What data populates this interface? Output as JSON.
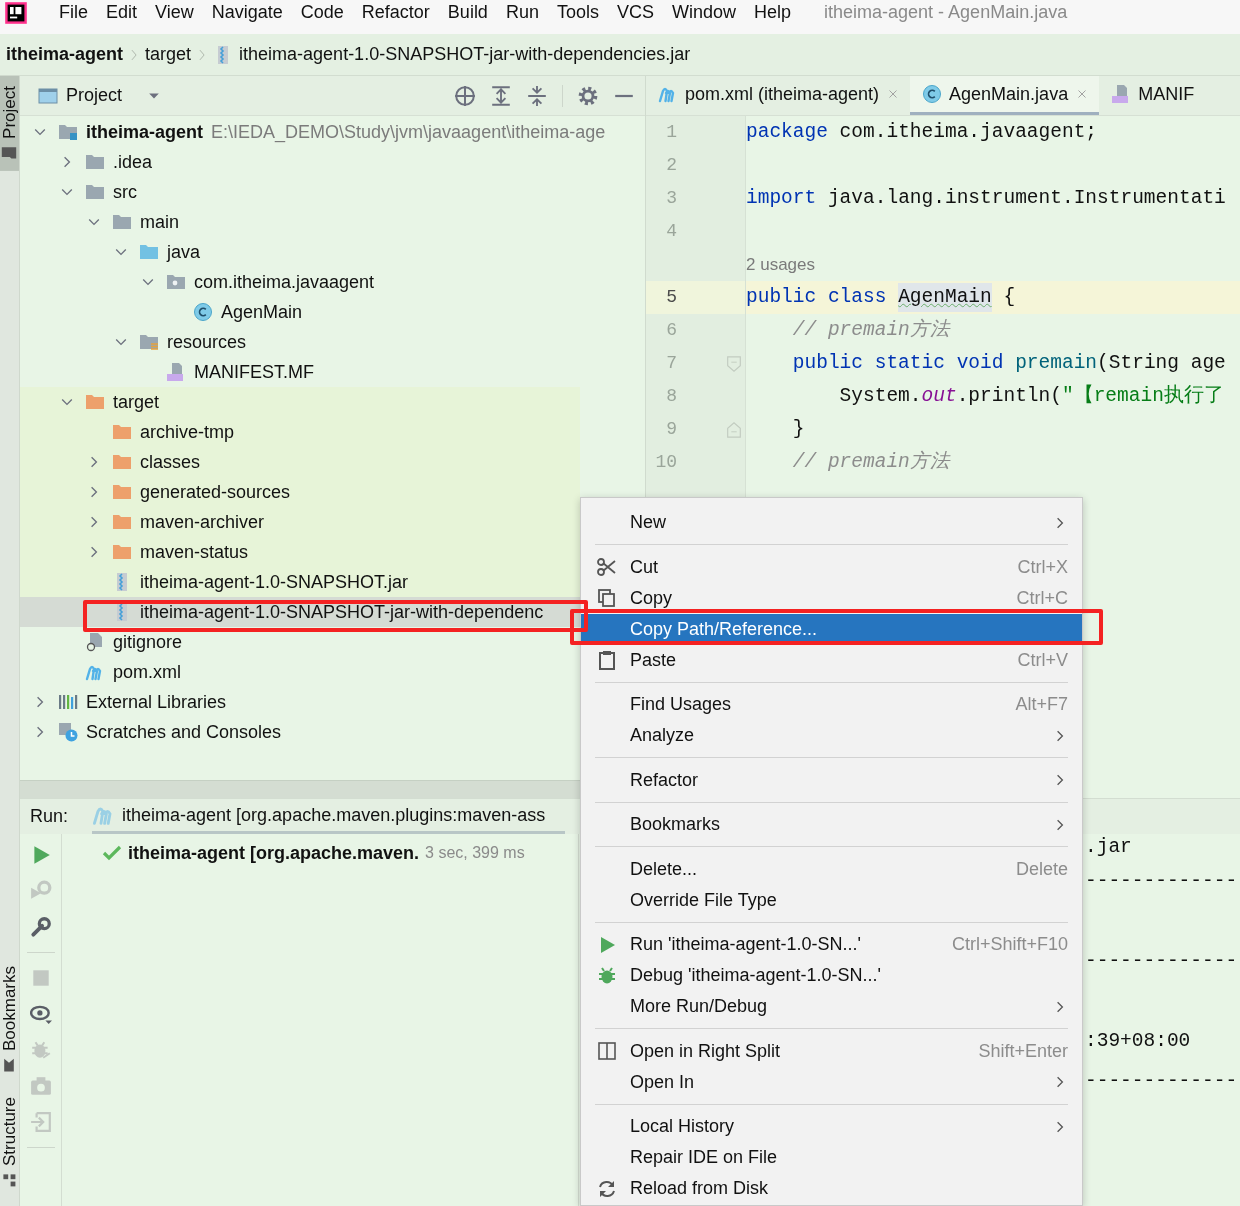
{
  "menubar": {
    "menus": [
      "File",
      "Edit",
      "View",
      "Navigate",
      "Code",
      "Refactor",
      "Build",
      "Run",
      "Tools",
      "VCS",
      "Window",
      "Help"
    ],
    "title": "itheima-agent - AgenMain.java"
  },
  "breadcrumbs": [
    {
      "label": "itheima-agent",
      "kind": "project"
    },
    {
      "label": "target",
      "kind": "folder"
    },
    {
      "label": "itheima-agent-1.0-SNAPSHOT-jar-with-dependencies.jar",
      "kind": "jar"
    }
  ],
  "side_tabs": [
    {
      "label": "Project",
      "kind": "project",
      "selected": true
    },
    {
      "label": "Bookmarks",
      "kind": "bookmarks",
      "selected": false
    },
    {
      "label": "Structure",
      "kind": "structure",
      "selected": false
    }
  ],
  "project_panel": {
    "title": "Project",
    "tree": [
      {
        "label": "itheima-agent",
        "path": "E:\\IEDA_DEMO\\Study\\jvm\\javaagent\\itheima-age",
        "kind": "project-folder",
        "expanded": true,
        "selected": false,
        "children": [
          {
            "label": ".idea",
            "kind": "folder",
            "expanded": false,
            "selected": false,
            "excluded": false
          },
          {
            "label": "src",
            "kind": "folder",
            "expanded": true,
            "selected": false,
            "excluded": false,
            "children": [
              {
                "label": "main",
                "kind": "folder",
                "expanded": true,
                "selected": false,
                "children": [
                  {
                    "label": "java",
                    "kind": "source-folder",
                    "expanded": true,
                    "selected": false,
                    "children": [
                      {
                        "label": "com.itheima.javaagent",
                        "kind": "package",
                        "expanded": true,
                        "selected": false,
                        "children": [
                          {
                            "label": "AgenMain",
                            "kind": "class",
                            "selected": false
                          }
                        ]
                      }
                    ]
                  },
                  {
                    "label": "resources",
                    "kind": "resources",
                    "expanded": true,
                    "selected": false,
                    "children": [
                      {
                        "label": "MANIFEST.MF",
                        "kind": "manifest",
                        "selected": false
                      }
                    ]
                  }
                ]
              }
            ]
          },
          {
            "label": "target",
            "kind": "excluded-folder",
            "expanded": true,
            "selected": false,
            "excluded": true,
            "children": [
              {
                "label": "archive-tmp",
                "kind": "excluded-folder",
                "selected": false
              },
              {
                "label": "classes",
                "kind": "excluded-folder",
                "expanded": false,
                "selected": false
              },
              {
                "label": "generated-sources",
                "kind": "excluded-folder",
                "expanded": false,
                "selected": false
              },
              {
                "label": "maven-archiver",
                "kind": "excluded-folder",
                "expanded": false,
                "selected": false
              },
              {
                "label": "maven-status",
                "kind": "excluded-folder",
                "expanded": false,
                "selected": false
              },
              {
                "label": "itheima-agent-1.0-SNAPSHOT.jar",
                "kind": "jar",
                "selected": false
              },
              {
                "label": "itheima-agent-1.0-SNAPSHOT-jar-with-dependenc",
                "kind": "jar",
                "selected": true
              }
            ]
          },
          {
            "label": "gitignore",
            "kind": "gitignore",
            "selected": false,
            "excluded": false
          },
          {
            "label": "pom.xml",
            "kind": "maven",
            "selected": false,
            "excluded": false
          }
        ]
      },
      {
        "label": "External Libraries",
        "kind": "libraries",
        "expanded": false,
        "selected": false
      },
      {
        "label": "Scratches and Consoles",
        "kind": "scratches",
        "expanded": false,
        "selected": false
      }
    ]
  },
  "editor": {
    "tabs": [
      {
        "label": "pom.xml (itheima-agent)",
        "kind": "maven",
        "selected": false,
        "closable": true
      },
      {
        "label": "AgenMain.java",
        "kind": "class",
        "selected": true,
        "closable": true
      },
      {
        "label": "MANIF",
        "kind": "manifest",
        "selected": false,
        "closable": false
      }
    ],
    "lines": [
      {
        "kind": "code",
        "number": "1",
        "current": false,
        "tokens": [
          {
            "kind": "keyword",
            "text": "package"
          },
          {
            "kind": "plain",
            "text": " com.itheima.javaagent;"
          }
        ]
      },
      {
        "kind": "code",
        "number": "2",
        "current": false
      },
      {
        "kind": "code",
        "number": "3",
        "current": false,
        "tokens": [
          {
            "kind": "keyword",
            "text": "import"
          },
          {
            "kind": "plain",
            "text": " java.lang.instrument.Instrumentati"
          }
        ]
      },
      {
        "kind": "code",
        "number": "4",
        "current": false
      },
      {
        "kind": "hint",
        "text": "2 usages"
      },
      {
        "kind": "code",
        "number": "5",
        "current": true,
        "tokens": [
          {
            "kind": "keyword",
            "text": "public class "
          },
          {
            "kind": "highlight",
            "text": "AgenMain"
          },
          {
            "kind": "plain",
            "text": " {"
          }
        ]
      },
      {
        "kind": "code",
        "number": "6",
        "current": false,
        "tokens": [
          {
            "kind": "comment",
            "text": "    // premain方法"
          }
        ]
      },
      {
        "kind": "code",
        "number": "7",
        "current": false,
        "fold_start": true,
        "tokens": [
          {
            "kind": "keyword",
            "text": "    public static void"
          },
          {
            "kind": "method",
            "text": " premain"
          },
          {
            "kind": "plain",
            "text": "(String age"
          }
        ]
      },
      {
        "kind": "code",
        "number": "8",
        "current": false,
        "tokens": [
          {
            "kind": "plain",
            "text": "        System."
          },
          {
            "kind": "field",
            "text": "out"
          },
          {
            "kind": "plain",
            "text": ".println("
          },
          {
            "kind": "string",
            "text": "\"【remain执行了"
          }
        ]
      },
      {
        "kind": "code",
        "number": "9",
        "current": false,
        "fold_end": true,
        "tokens": [
          {
            "kind": "plain",
            "text": "    }"
          }
        ]
      },
      {
        "kind": "code",
        "number": "10",
        "current": false,
        "tokens": [
          {
            "kind": "comment",
            "text": "    // premain方法"
          }
        ]
      }
    ]
  },
  "run_panel": {
    "label": "Run:",
    "tab": {
      "label": "itheima-agent [org.apache.maven.plugins:maven-ass",
      "kind": "maven"
    },
    "toolbar": [
      {
        "kind": "play",
        "disabled": false
      },
      {
        "kind": "rerun",
        "disabled": true
      },
      {
        "kind": "wrench",
        "disabled": false
      },
      {
        "kind": "separator"
      },
      {
        "kind": "stop",
        "disabled": true
      },
      {
        "kind": "eye",
        "disabled": false
      },
      {
        "kind": "bug",
        "disabled": true
      },
      {
        "kind": "camera",
        "disabled": true
      },
      {
        "kind": "exit",
        "disabled": true
      },
      {
        "kind": "separator"
      }
    ],
    "tree": [
      {
        "label": "itheima-agent [org.apache.maven.",
        "time": "3 sec, 399 ms",
        "succeeded": true
      }
    ],
    "console": [
      {
        "kind": "text",
        "text": ".jar"
      },
      {
        "kind": "text",
        "text": "-------------"
      },
      {
        "kind": "blank"
      },
      {
        "kind": "text",
        "text": "-------------"
      },
      {
        "kind": "blank"
      },
      {
        "kind": "text",
        "text": ":39+08:00"
      },
      {
        "kind": "text",
        "text": "-------------"
      }
    ]
  },
  "context_menu": [
    {
      "kind": "item",
      "label": "New",
      "submenu": true,
      "selected": false
    },
    {
      "kind": "separator"
    },
    {
      "kind": "cut",
      "label": "Cut",
      "shortcut": "Ctrl+X",
      "submenu": false,
      "selected": false
    },
    {
      "kind": "copy",
      "label": "Copy",
      "shortcut": "Ctrl+C",
      "submenu": false,
      "selected": false
    },
    {
      "kind": "item",
      "label": "Copy Path/Reference...",
      "submenu": false,
      "selected": true
    },
    {
      "kind": "paste",
      "label": "Paste",
      "shortcut": "Ctrl+V",
      "submenu": false,
      "selected": false
    },
    {
      "kind": "separator"
    },
    {
      "kind": "item",
      "label": "Find Usages",
      "shortcut": "Alt+F7",
      "submenu": false,
      "selected": false
    },
    {
      "kind": "item",
      "label": "Analyze",
      "submenu": true,
      "selected": false
    },
    {
      "kind": "separator"
    },
    {
      "kind": "item",
      "label": "Refactor",
      "submenu": true,
      "selected": false
    },
    {
      "kind": "separator"
    },
    {
      "kind": "item",
      "label": "Bookmarks",
      "submenu": true,
      "selected": false
    },
    {
      "kind": "separator"
    },
    {
      "kind": "item",
      "label": "Delete...",
      "shortcut": "Delete",
      "submenu": false,
      "selected": false
    },
    {
      "kind": "item",
      "label": "Override File Type",
      "submenu": false,
      "selected": false
    },
    {
      "kind": "separator"
    },
    {
      "kind": "run",
      "label": "Run 'itheima-agent-1.0-SN...'",
      "shortcut": "Ctrl+Shift+F10",
      "submenu": false,
      "selected": false
    },
    {
      "kind": "debug",
      "label": "Debug 'itheima-agent-1.0-SN...'",
      "submenu": false,
      "selected": false
    },
    {
      "kind": "item",
      "label": "More Run/Debug",
      "submenu": true,
      "selected": false
    },
    {
      "kind": "separator"
    },
    {
      "kind": "split",
      "label": "Open in Right Split",
      "shortcut": "Shift+Enter",
      "submenu": false,
      "selected": false
    },
    {
      "kind": "item",
      "label": "Open In",
      "submenu": true,
      "selected": false
    },
    {
      "kind": "separator"
    },
    {
      "kind": "item",
      "label": "Local History",
      "submenu": true,
      "selected": false
    },
    {
      "kind": "item",
      "label": "Repair IDE on File",
      "submenu": false,
      "selected": false
    },
    {
      "kind": "reload",
      "label": "Reload from Disk",
      "submenu": false,
      "selected": false
    }
  ]
}
